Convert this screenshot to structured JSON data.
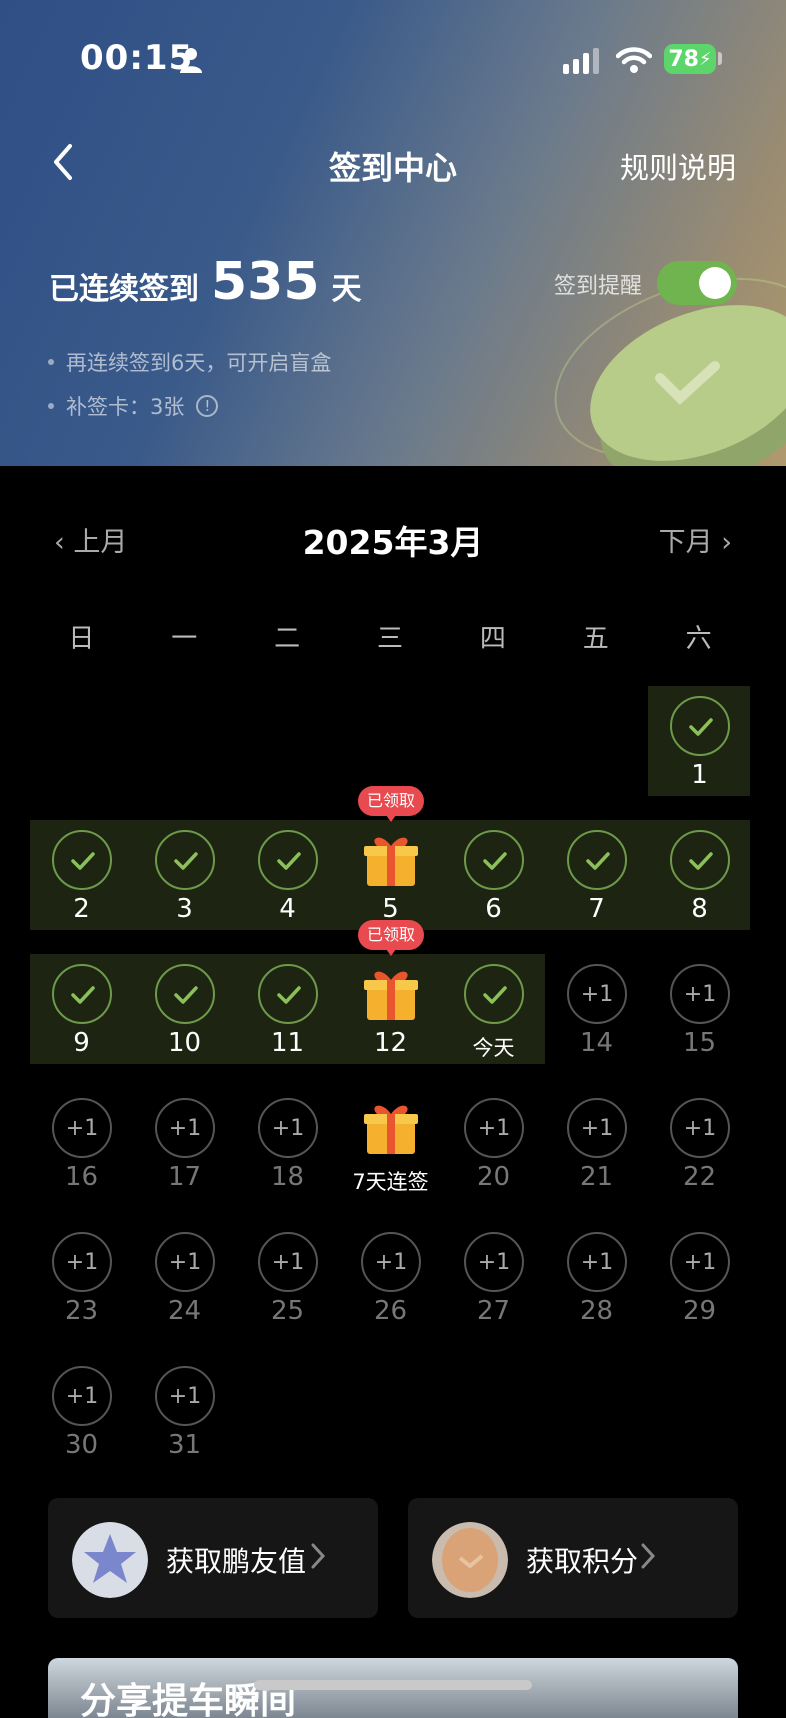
{
  "status_bar": {
    "time": "00:15",
    "battery": "78"
  },
  "header": {
    "title": "签到中心",
    "rules_label": "规则说明"
  },
  "streak": {
    "prefix": "已连续签到",
    "days": "535",
    "suffix": "天"
  },
  "reminder": {
    "label": "签到提醒",
    "enabled": true
  },
  "bullets": [
    "再连续签到6天，可开启盲盒",
    "补签卡：3张"
  ],
  "calendar": {
    "prev_label": "上月",
    "next_label": "下月",
    "month_title": "2025年3月",
    "weekdays": [
      "日",
      "一",
      "二",
      "三",
      "四",
      "五",
      "六"
    ],
    "plus_label": "+1",
    "claimed_badge": "已领取",
    "today_label": "今天",
    "gift_streak_label": "7天连签",
    "days": [
      {
        "label": "1",
        "state": "done"
      },
      {
        "label": "2",
        "state": "done"
      },
      {
        "label": "3",
        "state": "done"
      },
      {
        "label": "4",
        "state": "done"
      },
      {
        "label": "5",
        "state": "gift-claimed"
      },
      {
        "label": "6",
        "state": "done"
      },
      {
        "label": "7",
        "state": "done"
      },
      {
        "label": "8",
        "state": "done"
      },
      {
        "label": "9",
        "state": "done"
      },
      {
        "label": "10",
        "state": "done"
      },
      {
        "label": "11",
        "state": "done"
      },
      {
        "label": "12",
        "state": "gift-claimed"
      },
      {
        "label": "今天",
        "state": "done-today"
      },
      {
        "label": "14",
        "state": "future"
      },
      {
        "label": "15",
        "state": "future"
      },
      {
        "label": "16",
        "state": "future"
      },
      {
        "label": "17",
        "state": "future"
      },
      {
        "label": "18",
        "state": "future"
      },
      {
        "label": "7天连签",
        "state": "gift-future"
      },
      {
        "label": "20",
        "state": "future"
      },
      {
        "label": "21",
        "state": "future"
      },
      {
        "label": "22",
        "state": "future"
      },
      {
        "label": "23",
        "state": "future"
      },
      {
        "label": "24",
        "state": "future"
      },
      {
        "label": "25",
        "state": "future"
      },
      {
        "label": "26",
        "state": "future"
      },
      {
        "label": "27",
        "state": "future"
      },
      {
        "label": "28",
        "state": "future"
      },
      {
        "label": "29",
        "state": "future"
      },
      {
        "label": "30",
        "state": "future"
      },
      {
        "label": "31",
        "state": "future"
      }
    ]
  },
  "cards": [
    {
      "label": "获取鹏友值",
      "icon": "star-crystal-icon"
    },
    {
      "label": "获取积分",
      "icon": "coin-icon"
    }
  ],
  "banner": {
    "text": "分享提车瞬间"
  },
  "colors": {
    "accent_green": "#6d9a4a",
    "badge_red": "#e94a4f",
    "toggle_green": "#6fb44f"
  }
}
